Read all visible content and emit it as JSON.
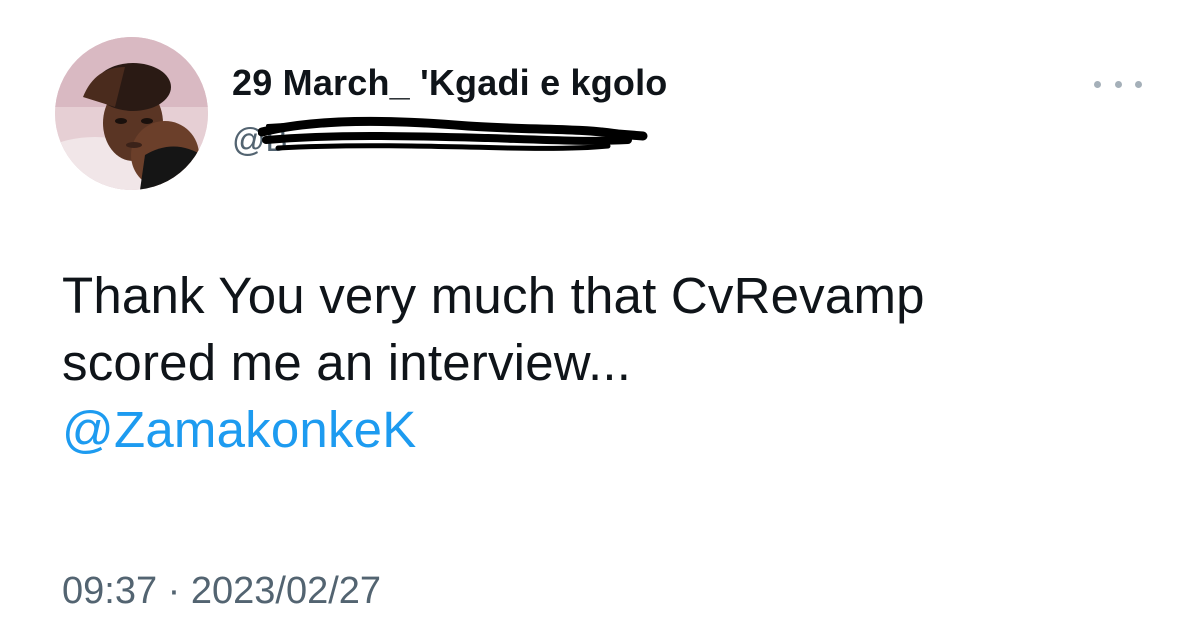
{
  "tweet": {
    "display_name": "29 March_ 'Kgadi e kgolo",
    "handle": "@B",
    "avatar_icon": "profile-photo-avatar",
    "more_icon": "more-options-icon",
    "text_line_1": "Thank You very much that CvRevamp",
    "text_line_2": "scored me an interview...",
    "mention": "@ZamakonkeK",
    "time": "09:37",
    "separator": "·",
    "date": "2023/02/27"
  },
  "colors": {
    "mention": "#1d9bf0",
    "secondary_text": "#536471",
    "primary_text": "#0f1419"
  }
}
